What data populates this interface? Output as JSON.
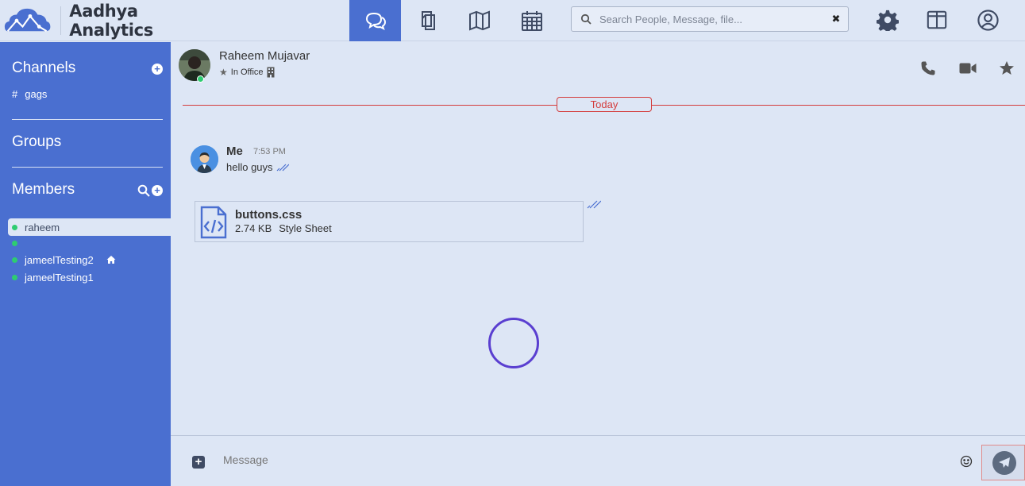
{
  "app": {
    "name": "Aadhya Analytics"
  },
  "search": {
    "placeholder": "Search People, Message, file...",
    "clear_label": "✖"
  },
  "sidebar": {
    "channels_title": "Channels",
    "channels": [
      {
        "prefix": "#",
        "name": "gags"
      }
    ],
    "groups_title": "Groups",
    "members_title": "Members",
    "members": [
      {
        "name": "raheem",
        "status": "online",
        "selected": true
      },
      {
        "name": "",
        "status": "online",
        "selected": false
      },
      {
        "name": "jameelTesting2",
        "status": "online",
        "selected": false,
        "extra_icon": "home-icon"
      },
      {
        "name": "jameelTesting1",
        "status": "online",
        "selected": false
      }
    ]
  },
  "chat": {
    "contact_name": "Raheem Mujavar",
    "contact_status": "In Office",
    "day_label": "Today",
    "messages": [
      {
        "sender": "Me",
        "time": "7:53 PM",
        "text": "hello guys"
      }
    ],
    "file": {
      "name": "buttons.css",
      "size": "2.74 KB",
      "type": "Style Sheet"
    }
  },
  "composer": {
    "placeholder": "Message",
    "attach_label": "+"
  },
  "colors": {
    "accent": "#4a6fd0",
    "background": "#dde6f5",
    "online": "#2ecc71",
    "day_divider": "#d43c3c",
    "spinner": "#5a3fd0"
  }
}
